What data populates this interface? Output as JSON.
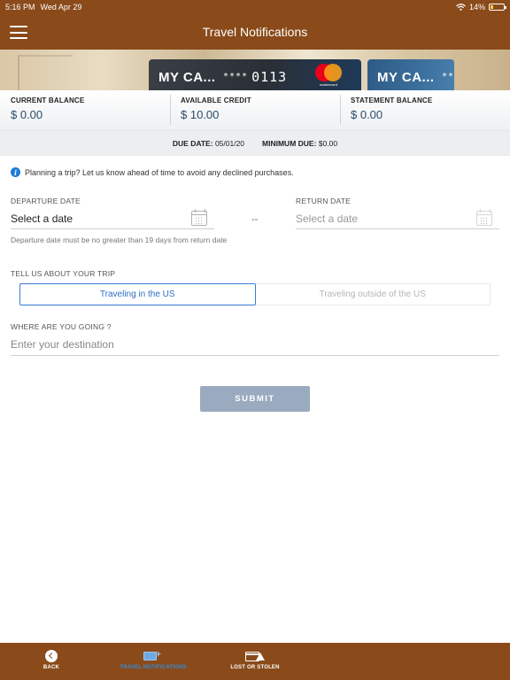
{
  "status_bar": {
    "time": "5:16 PM",
    "date": "Wed Apr 29",
    "battery": "14%",
    "wifi_icon": "wifi-icon",
    "battery_icon": "battery-charging-icon"
  },
  "header": {
    "title": "Travel Notifications",
    "menu_icon": "hamburger-menu-icon"
  },
  "cards": [
    {
      "name": "MY CA...",
      "masked": "****",
      "last4": "0113",
      "network": "mastercard"
    },
    {
      "name": "MY CA...",
      "masked": "**",
      "last4": ""
    }
  ],
  "balances": [
    {
      "label": "CURRENT BALANCE",
      "value": "$ 0.00"
    },
    {
      "label": "AVAILABLE CREDIT",
      "value": "$ 10.00"
    },
    {
      "label": "STATEMENT BALANCE",
      "value": "$ 0.00"
    }
  ],
  "due": {
    "due_date_label": "DUE DATE:",
    "due_date_value": "05/01/20",
    "min_due_label": "MINIMUM DUE:",
    "min_due_value": "$0.00"
  },
  "form": {
    "info_text": "Planning a trip? Let us know ahead of time to avoid any declined purchases.",
    "departure_label": "DEPARTURE DATE",
    "departure_value": "Select a date",
    "return_label": "RETURN DATE",
    "return_value": "Select a date",
    "separator": "--",
    "date_hint": "Departure date must be no greater than 19 days from return date",
    "trip_label": "TELL US ABOUT YOUR TRIP",
    "trip_options": [
      "Traveling in the US",
      "Traveling outside of the US"
    ],
    "trip_selected": "Traveling in the US",
    "destination_label": "WHERE ARE YOU GOING ?",
    "destination_placeholder": "Enter your destination",
    "submit_label": "SUBMIT"
  },
  "tabbar": {
    "items": [
      {
        "label": "BACK",
        "icon": "back-arrow-icon"
      },
      {
        "label": "TRAVEL NOTIFICATIONS",
        "icon": "travel-card-plane-icon",
        "active": true
      },
      {
        "label": "LOST OR STOLEN",
        "icon": "card-warning-icon"
      }
    ]
  },
  "colors": {
    "brand_brown": "#8a4a1a",
    "balance_value": "#2b4a6a",
    "active_blue": "#3a7bd5",
    "submit_disabled": "#9aaabf"
  }
}
